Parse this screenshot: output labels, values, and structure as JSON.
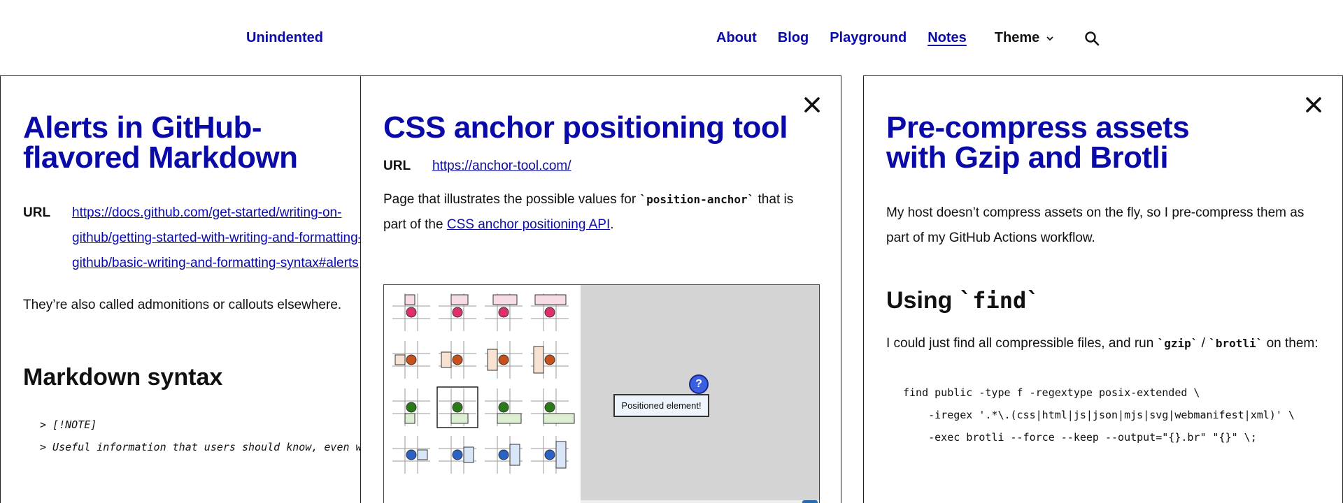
{
  "header": {
    "logo": "Unindented",
    "nav": [
      {
        "label": "About"
      },
      {
        "label": "Blog"
      },
      {
        "label": "Playground"
      },
      {
        "label": "Notes"
      }
    ],
    "theme_label": "Theme"
  },
  "panel1": {
    "title_line1": "Alerts in GitHub-",
    "title_line2": "flavored Markdown",
    "url_label": "URL",
    "url_line1": "https://docs.github.com/get-started/writing-on-",
    "url_line2": "github/getting-started-with-writing-and-formatting-on-",
    "url_line3": "github/basic-writing-and-formatting-syntax#alerts",
    "intro": "They’re also called admonitions or callouts elsewhere.",
    "heading": "Markdown syntax",
    "code_line1": "> [!NOTE]",
    "code_line2": "> Useful information that users should know, even when skimming content."
  },
  "panel2": {
    "title": "CSS anchor positioning tool",
    "url_label": "URL",
    "url": "https://anchor-tool.com/",
    "desc_before": "Page that illustrates the possible values for ",
    "desc_code": "`position-anchor`",
    "desc_middle": " that is part of the ",
    "desc_link": "CSS anchor positioning API",
    "desc_after": ".",
    "demo_positioned": "Positioned element!",
    "demo_anchor": "?"
  },
  "panel3": {
    "title_line1": "Pre-compress assets",
    "title_line2": "with Gzip and Brotli",
    "intro": "My host doesn’t compress assets on the fly, so I pre-compress them as part of my GitHub Actions workflow.",
    "heading_prefix": "Using ",
    "heading_code": "`find`",
    "para_before": "I could just find all compressible files, and run ",
    "para_code1": "`gzip`",
    "para_sep": " / ",
    "para_code2": "`brotli`",
    "para_after": " on them:",
    "code_line1": "find public -type f -regextype posix-extended \\",
    "code_line2": "    -iregex '.*\\.(css|html|js|json|mjs|svg|webmanifest|xml)' \\",
    "code_line3": "    -exec brotli --force --keep --output=\"{}.br\" \"{}\" \\;"
  },
  "colors": {
    "link": "#0a0aa8",
    "demo_pink": "#e0306a",
    "demo_orange": "#c8501a",
    "demo_green": "#2a7a1a",
    "demo_blue": "#2a62c8"
  }
}
